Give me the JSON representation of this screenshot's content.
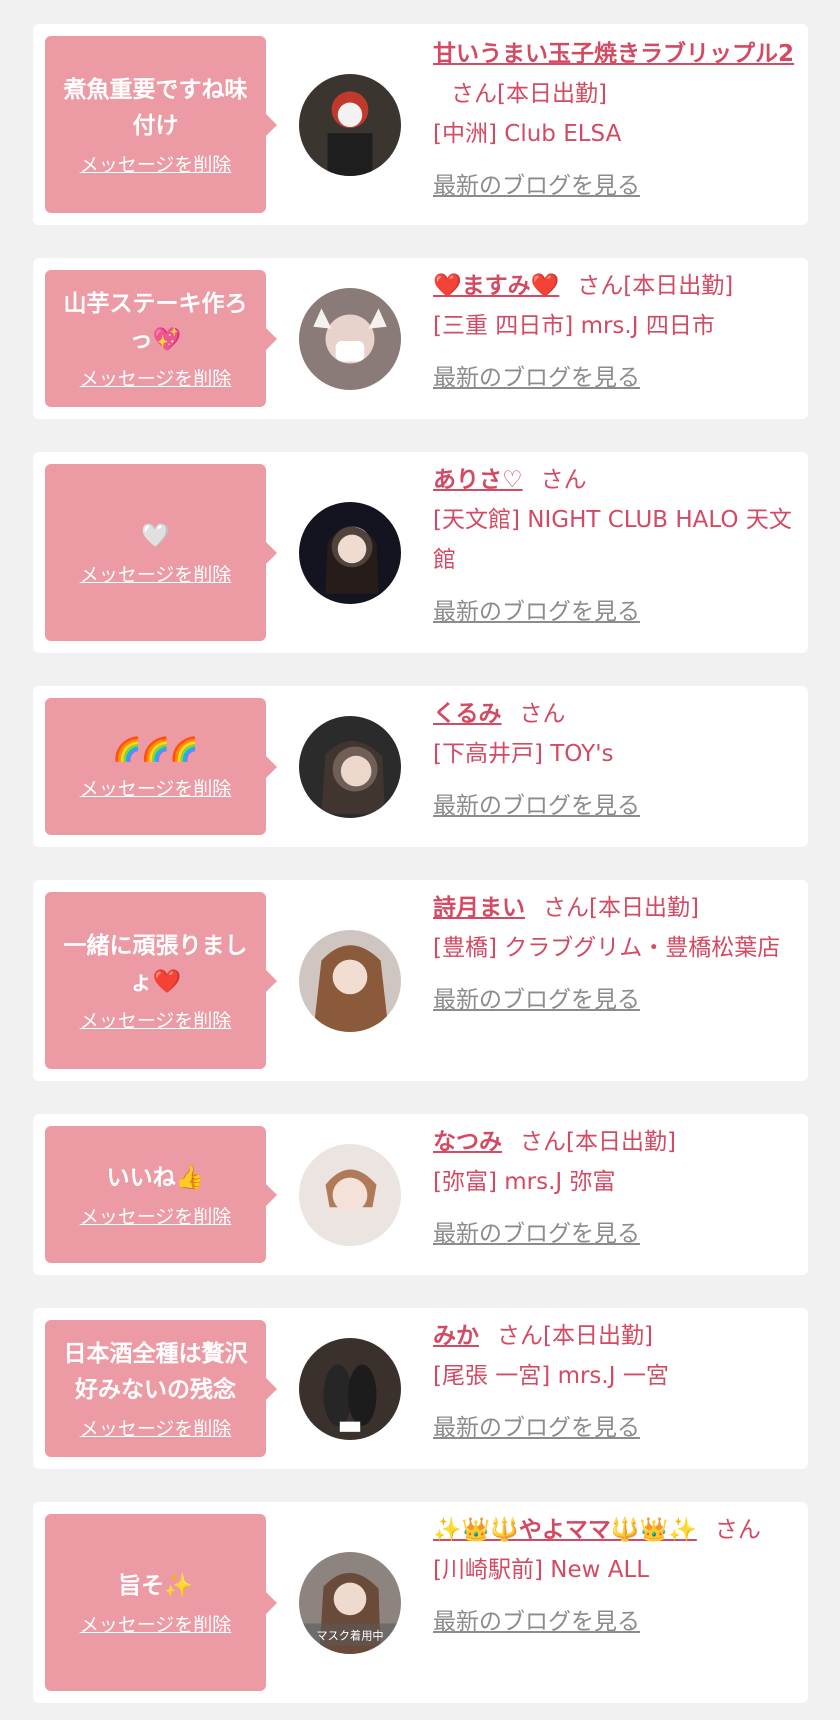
{
  "delete_label": "メッセージを削除",
  "blog_label": "最新のブログを見る",
  "colors": {
    "accent": "#d34a63",
    "bubble": "#ec9ba5",
    "muted": "#8c8c8c",
    "background": "#f1f1f1"
  },
  "entries": [
    {
      "message": "煮魚重要ですね味付け",
      "name": "甘いうまい玉子焼きラブリップル2",
      "suffix": "さん[本日出勤]",
      "shop": "[中洲] Club ELSA"
    },
    {
      "message": "山芋ステーキ作ろっ💖",
      "name": "❤️ますみ❤️",
      "suffix": "さん[本日出勤]",
      "shop": "[三重 四日市] mrs.J 四日市"
    },
    {
      "message": "🤍",
      "name": "ありさ♡",
      "suffix": "さん",
      "shop": "[天文館] NIGHT CLUB HALO 天文館"
    },
    {
      "message": "🌈🌈🌈",
      "name": "くるみ",
      "suffix": "さん",
      "shop": "[下高井戸] TOY's"
    },
    {
      "message": "一緒に頑張りましょ❤️",
      "name": "詩月まい",
      "suffix": "さん[本日出勤]",
      "shop": "[豊橋] クラブグリム・豊橋松葉店"
    },
    {
      "message": "いいね👍",
      "name": "なつみ",
      "suffix": "さん[本日出勤]",
      "shop": "[弥富] mrs.J 弥富"
    },
    {
      "message": "日本酒全種は贅沢好みないの残念",
      "name": "みか",
      "suffix": "さん[本日出勤]",
      "shop": "[尾張 一宮] mrs.J 一宮"
    },
    {
      "message": "旨そ✨",
      "name": "✨👑🔱やよママ🔱👑✨",
      "suffix": "さん",
      "shop": "[川崎駅前] New ALL",
      "avatar_caption": "マスク着用中"
    }
  ]
}
